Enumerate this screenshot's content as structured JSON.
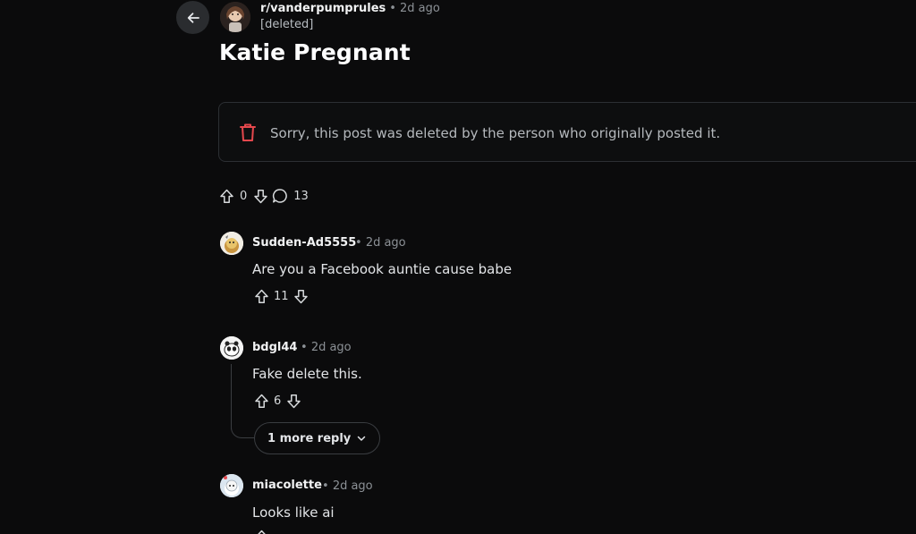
{
  "post": {
    "subreddit": "r/vanderpumprules",
    "dot": "•",
    "time": "2d ago",
    "author": "[deleted]",
    "title": "Katie Pregnant",
    "deleted_message": "Sorry, this post was deleted by the person who originally posted it.",
    "votes": "0",
    "comments": "13"
  },
  "comments": [
    {
      "author": "Sudden-Ad5555",
      "dot": "•",
      "time": "2d ago",
      "body": "Are you a Facebook auntie cause babe",
      "votes": "11"
    },
    {
      "author": "bdgl44",
      "dot": "•",
      "time": "2d ago",
      "body": "Fake delete this.",
      "votes": "6",
      "more_replies": "1 more reply"
    },
    {
      "author": "miacolette",
      "dot": "•",
      "time": "2d ago",
      "body": "Looks like ai"
    }
  ],
  "icons": {
    "back": "arrow-left-icon",
    "trash": "trash-icon",
    "upvote": "upvote-icon",
    "downvote": "downvote-icon",
    "comment": "comment-icon",
    "chevron": "chevron-down-icon"
  },
  "colors": {
    "background": "#0b0b0c",
    "trash_red": "#e5484d",
    "muted_text": "#8c9196",
    "border": "#2c2f33"
  }
}
